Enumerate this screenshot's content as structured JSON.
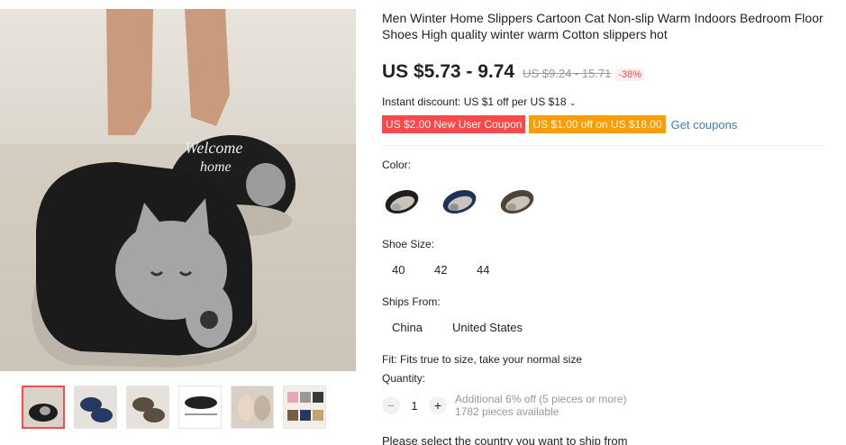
{
  "product": {
    "title": "Men Winter Home Slippers Cartoon Cat Non-slip Warm Indoors Bedroom Floor Shoes High quality winter warm Cotton slippers hot"
  },
  "price": {
    "current": "US $5.73 - 9.74",
    "original": "US $9.24 - 15.71",
    "discount": "-38%"
  },
  "instant_discount": "Instant discount: US $1 off per US $18",
  "coupons": {
    "new_user": "US $2.00 New User Coupon",
    "store": "US $1.00 off on US $18.00",
    "get_label": "Get coupons"
  },
  "color": {
    "label": "Color:",
    "options": [
      "black-slipper",
      "navy-slipper",
      "brown-slipper"
    ]
  },
  "shoe_size": {
    "label": "Shoe Size:",
    "options": [
      "40",
      "42",
      "44"
    ]
  },
  "ships_from": {
    "label": "Ships From:",
    "options": [
      "China",
      "United States"
    ]
  },
  "fit": "Fit: Fits true to size, take your normal size",
  "quantity": {
    "label": "Quantity:",
    "value": "1",
    "minus": "−",
    "plus": "+",
    "offer": "Additional 6% off (5 pieces or more)",
    "available": "1782 pieces available"
  },
  "ship_prompt": "Please select the country you want to ship from",
  "colors": {
    "accent_red": "#ff4747",
    "accent_orange": "#ff9c00",
    "link_blue": "#3c7cc4"
  }
}
